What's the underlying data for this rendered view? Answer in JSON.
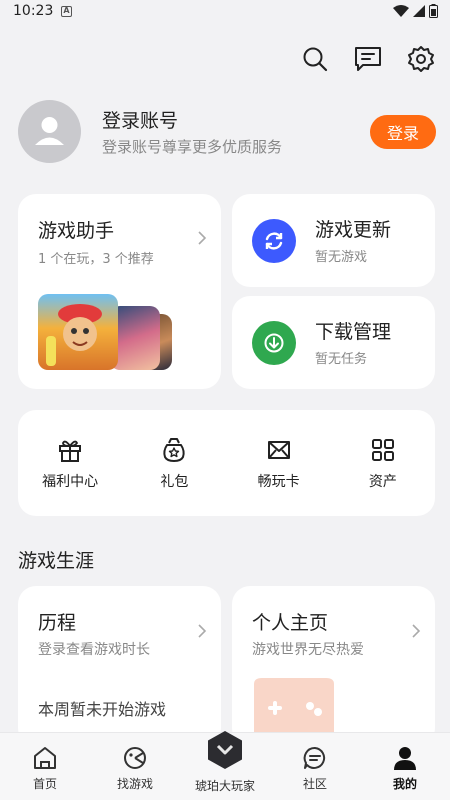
{
  "status": {
    "time": "10:23",
    "notif": "A"
  },
  "header": {
    "icons": [
      "search-icon",
      "message-icon",
      "settings-icon"
    ]
  },
  "login": {
    "title": "登录账号",
    "subtitle": "登录账号尊享更多优质服务",
    "button": "登录"
  },
  "assistant": {
    "title": "游戏助手",
    "subtitle": "1 个在玩，3 个推荐"
  },
  "update": {
    "title": "游戏更新",
    "subtitle": "暂无游戏"
  },
  "download": {
    "title": "下载管理",
    "subtitle": "暂无任务"
  },
  "actions": [
    {
      "label": "福利中心",
      "icon": "gift-icon"
    },
    {
      "label": "礼包",
      "icon": "gift-bag-icon"
    },
    {
      "label": "畅玩卡",
      "icon": "card-icon"
    },
    {
      "label": "资产",
      "icon": "grid-icon"
    }
  ],
  "career": {
    "section_title": "游戏生涯",
    "history": {
      "title": "历程",
      "subtitle": "登录查看游戏时长",
      "note": "本周暂未开始游戏"
    },
    "profile": {
      "title": "个人主页",
      "subtitle": "游戏世界无尽热爱"
    }
  },
  "nav": {
    "items": [
      {
        "label": "首页",
        "icon": "home-icon"
      },
      {
        "label": "找游戏",
        "icon": "find-game-icon"
      },
      {
        "label": "琥珀大玩家",
        "icon": "amber-logo-icon"
      },
      {
        "label": "社区",
        "icon": "community-icon"
      },
      {
        "label": "我的",
        "icon": "profile-icon"
      }
    ],
    "active_index": 4
  },
  "colors": {
    "accent": "#ff6b12",
    "update": "#3d5afe",
    "download": "#2fa84f"
  }
}
